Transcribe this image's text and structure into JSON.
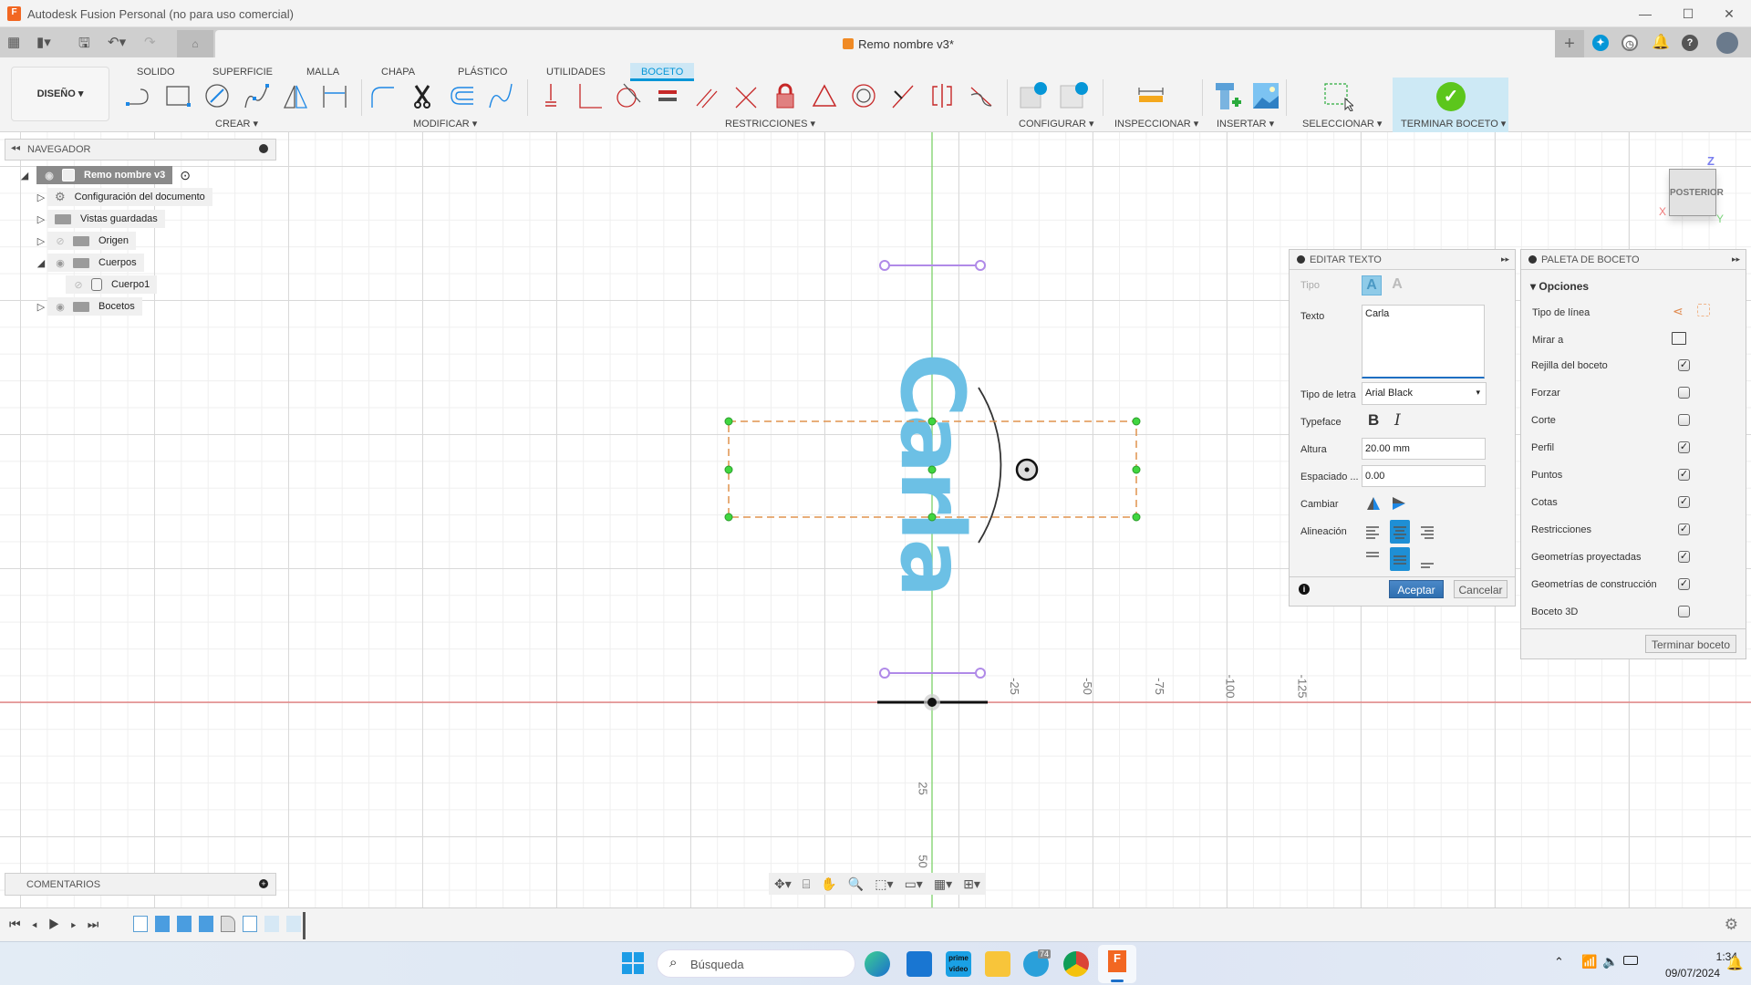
{
  "window": {
    "title": "Autodesk Fusion Personal (no para uso comercial)",
    "document_tab": "Remo nombre v3*",
    "controls": {
      "minimize": "—",
      "maximize": "☐",
      "close": "✕"
    }
  },
  "header_icons": [
    "new-tab",
    "extensions",
    "job-status",
    "notifications",
    "help",
    "user-avatar"
  ],
  "toolbar": {
    "workspace": "DISEÑO",
    "tabs": [
      {
        "label": "SOLIDO",
        "active": false
      },
      {
        "label": "SUPERFICIE",
        "active": false
      },
      {
        "label": "MALLA",
        "active": false
      },
      {
        "label": "CHAPA",
        "active": false
      },
      {
        "label": "PLÁSTICO",
        "active": false
      },
      {
        "label": "UTILIDADES",
        "active": false
      },
      {
        "label": "BOCETO",
        "active": true
      }
    ],
    "groups": {
      "crear": "CREAR ▾",
      "modificar": "MODIFICAR ▾",
      "restricciones": "RESTRICCIONES ▾",
      "configurar": "CONFIGURAR ▾",
      "inspeccionar": "INSPECCIONAR ▾",
      "insertar": "INSERTAR ▾",
      "seleccionar": "SELECCIONAR ▾",
      "terminar": "TERMINAR BOCETO ▾"
    }
  },
  "navigator": {
    "title": "NAVEGADOR",
    "items": [
      {
        "label": "Remo nombre v3",
        "level": 0,
        "expanded": true,
        "visible": true
      },
      {
        "label": "Configuración del documento",
        "level": 1,
        "expanded": false
      },
      {
        "label": "Vistas guardadas",
        "level": 1,
        "expanded": false
      },
      {
        "label": "Origen",
        "level": 1,
        "expanded": false,
        "visible": false
      },
      {
        "label": "Cuerpos",
        "level": 1,
        "expanded": true,
        "visible": true
      },
      {
        "label": "Cuerpo1",
        "level": 2,
        "visible": false
      },
      {
        "label": "Bocetos",
        "level": 1,
        "expanded": false,
        "visible": true
      }
    ]
  },
  "canvas": {
    "sketch_text": "Carla",
    "text_color": "#6cc0e5",
    "axis_labels_x": [
      "-25",
      "-50",
      "-75",
      "-100",
      "-125"
    ],
    "axis_labels_y": [
      "25",
      "50"
    ],
    "viewcube": {
      "face": "POSTERIOR",
      "axes": {
        "x": "X",
        "y": "Y",
        "z": "Z"
      }
    }
  },
  "edit_text": {
    "title": "EDITAR TEXTO",
    "tipo_label": "Tipo",
    "texto_label": "Texto",
    "texto_value": "Carla",
    "font_label": "Tipo de letra",
    "font_value": "Arial Black",
    "typeface_label": "Typeface",
    "bold": "B",
    "italic": "I",
    "altura_label": "Altura",
    "altura_value": "20.00 mm",
    "espaciado_label": "Espaciado ...",
    "espaciado_value": "0.00",
    "cambiar_label": "Cambiar",
    "alineacion_label": "Alineación",
    "horizontal_alignment": "center",
    "vertical_alignment": "middle",
    "accept": "Aceptar",
    "cancel": "Cancelar"
  },
  "palette": {
    "title": "PALETA DE BOCETO",
    "section": "Opciones",
    "tipo_linea": "Tipo de línea",
    "mirar_a": "Mirar a",
    "options": [
      {
        "label": "Rejilla del boceto",
        "checked": true
      },
      {
        "label": "Forzar",
        "checked": false
      },
      {
        "label": "Corte",
        "checked": false
      },
      {
        "label": "Perfil",
        "checked": true
      },
      {
        "label": "Puntos",
        "checked": true
      },
      {
        "label": "Cotas",
        "checked": true
      },
      {
        "label": "Restricciones",
        "checked": true
      },
      {
        "label": "Geometrías proyectadas",
        "checked": true
      },
      {
        "label": "Geometrías de construcción",
        "checked": true
      },
      {
        "label": "Boceto 3D",
        "checked": false
      }
    ],
    "finish": "Terminar boceto"
  },
  "comments": {
    "title": "COMENTARIOS"
  },
  "taskbar": {
    "search_placeholder": "Búsqueda",
    "apps": [
      "start",
      "edge",
      "mail",
      "prime-video",
      "file-explorer",
      "telegram",
      "chrome",
      "fusion"
    ],
    "telegram_badge": "74",
    "time": "1:34",
    "date": "09/07/2024"
  }
}
